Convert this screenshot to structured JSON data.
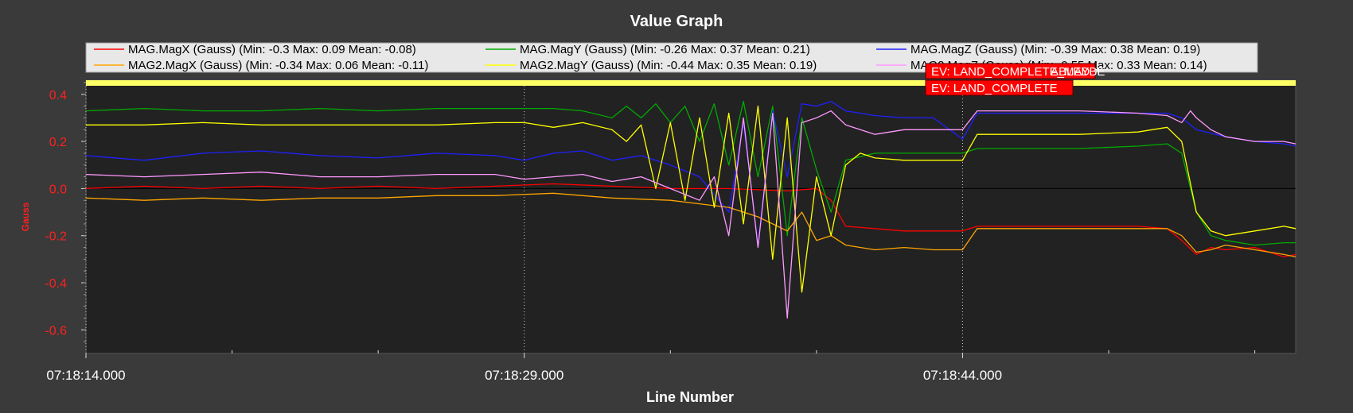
{
  "chart_data": {
    "type": "line",
    "title": "Value Graph",
    "xlabel": "Line Number",
    "ylabel": "Gauss",
    "x_range": [
      0,
      41.4
    ],
    "ylim": [
      -0.7,
      0.46
    ],
    "y_ticks": [
      -0.6,
      -0.4,
      -0.2,
      0.0,
      0.2,
      0.4
    ],
    "y_tick_labels": [
      "-0.6",
      "-0.4",
      "-0.2",
      "0.0",
      "0.2",
      "0.4"
    ],
    "x_ticks": [
      0,
      15,
      30
    ],
    "x_tick_labels": [
      "07:18:14.000",
      "07:18:29.000",
      "07:18:44.000"
    ],
    "x_minor_ticks": [
      5,
      10,
      20,
      25,
      35,
      40
    ],
    "grid": "vertical dotted at major ticks",
    "legend_placement": "top",
    "legend": [
      {
        "label": "MAG.MagX (Gauss) (Min: -0.3 Max: 0.09 Mean: -0.08)",
        "color": "#ff0000"
      },
      {
        "label": "MAG.MagY (Gauss) (Min: -0.26 Max: 0.37 Mean: 0.21)",
        "color": "#00aa00"
      },
      {
        "label": "MAG.MagZ (Gauss) (Min: -0.39 Max: 0.38 Mean: 0.19)",
        "color": "#1f1fff"
      },
      {
        "label": "MAG2.MagX (Gauss) (Min: -0.34 Max: 0.06 Mean: -0.11)",
        "color": "#ffa500"
      },
      {
        "label": "MAG2.MagY (Gauss) (Min: -0.44 Max: 0.35 Mean: 0.19)",
        "color": "#ffff00"
      },
      {
        "label": "MAG2.MagZ (Gauss) (Min: -0.55 Max: 0.33 Mean: 0.14)",
        "color": "#ff99ff"
      }
    ],
    "event_labels": [
      "EV: LAND_COMPLETE_MAYBE",
      "EV: LAND_COMPLETE"
    ],
    "event_label_partial": "ABLED",
    "colors": {
      "background": "#3a3a3a",
      "plot_background": "#222222",
      "axis_text": "#ff2020",
      "text": "#ffffff",
      "event_bg": "#ff0000",
      "top_band": "#ffff66"
    },
    "series": [
      {
        "name": "MAG.MagX (Gauss)",
        "color": "#ff0000",
        "x": [
          0,
          2,
          4,
          6,
          8,
          10,
          12,
          14,
          16,
          18,
          20,
          22,
          24,
          25,
          25.5,
          26,
          27,
          28,
          29,
          30,
          30.5,
          31,
          32,
          33,
          34,
          35,
          36,
          37,
          37.5,
          38,
          38.5,
          39,
          40,
          41,
          41.4
        ],
        "y": [
          0.0,
          0.01,
          0.0,
          0.01,
          0.0,
          0.01,
          0.0,
          0.01,
          0.02,
          0.01,
          0.0,
          0.0,
          -0.01,
          0.0,
          -0.05,
          -0.16,
          -0.17,
          -0.18,
          -0.18,
          -0.18,
          -0.16,
          -0.16,
          -0.16,
          -0.16,
          -0.16,
          -0.16,
          -0.16,
          -0.17,
          -0.22,
          -0.28,
          -0.25,
          -0.26,
          -0.25,
          -0.29,
          -0.28
        ]
      },
      {
        "name": "MAG.MagY (Gauss)",
        "color": "#00aa00",
        "x": [
          0,
          2,
          4,
          6,
          8,
          10,
          12,
          14,
          16,
          17,
          18,
          18.5,
          19,
          19.5,
          20,
          20.5,
          21,
          21.5,
          22,
          22.5,
          23,
          23.5,
          24,
          24.5,
          25,
          25.5,
          26,
          27,
          28,
          29,
          30,
          30.5,
          32,
          34,
          36,
          37,
          37.5,
          38,
          38.5,
          39,
          40,
          41,
          41.4
        ],
        "y": [
          0.33,
          0.34,
          0.33,
          0.33,
          0.34,
          0.33,
          0.34,
          0.34,
          0.34,
          0.33,
          0.3,
          0.35,
          0.3,
          0.36,
          0.28,
          0.35,
          0.2,
          0.36,
          0.1,
          0.37,
          0.05,
          0.35,
          -0.2,
          0.3,
          0.08,
          -0.1,
          0.12,
          0.15,
          0.15,
          0.15,
          0.15,
          0.17,
          0.17,
          0.17,
          0.18,
          0.19,
          0.15,
          -0.1,
          -0.2,
          -0.22,
          -0.24,
          -0.23,
          -0.23
        ]
      },
      {
        "name": "MAG.MagZ (Gauss)",
        "color": "#1f1fff",
        "x": [
          0,
          2,
          4,
          6,
          8,
          10,
          12,
          14,
          15,
          16,
          17,
          18,
          19,
          20,
          21,
          22,
          22.5,
          23,
          23.5,
          24,
          24.5,
          25,
          25.5,
          26,
          27,
          28,
          29,
          30,
          30.5,
          32,
          34,
          36,
          37,
          37.5,
          38,
          39,
          40,
          41,
          41.4
        ],
        "y": [
          0.14,
          0.12,
          0.15,
          0.16,
          0.14,
          0.13,
          0.15,
          0.14,
          0.12,
          0.15,
          0.16,
          0.12,
          0.14,
          0.1,
          0.05,
          -0.1,
          0.28,
          -0.24,
          0.33,
          0.05,
          0.36,
          0.35,
          0.37,
          0.33,
          0.31,
          0.3,
          0.3,
          0.21,
          0.32,
          0.32,
          0.32,
          0.32,
          0.32,
          0.3,
          0.25,
          0.22,
          0.2,
          0.19,
          0.18
        ]
      },
      {
        "name": "MAG2.MagX (Gauss)",
        "color": "#ffa500",
        "x": [
          0,
          2,
          4,
          6,
          8,
          10,
          12,
          14,
          16,
          18,
          20,
          22,
          23,
          24,
          24.5,
          25,
          25.5,
          26,
          27,
          28,
          29,
          30,
          30.5,
          32,
          34,
          36,
          37,
          37.5,
          38,
          38.5,
          39,
          40,
          41,
          41.4
        ],
        "y": [
          -0.04,
          -0.05,
          -0.04,
          -0.05,
          -0.04,
          -0.04,
          -0.03,
          -0.03,
          -0.02,
          -0.04,
          -0.05,
          -0.08,
          -0.12,
          -0.18,
          -0.1,
          -0.22,
          -0.2,
          -0.24,
          -0.26,
          -0.25,
          -0.26,
          -0.26,
          -0.17,
          -0.17,
          -0.17,
          -0.17,
          -0.17,
          -0.2,
          -0.27,
          -0.26,
          -0.24,
          -0.26,
          -0.28,
          -0.29
        ]
      },
      {
        "name": "MAG2.MagY (Gauss)",
        "color": "#ffff00",
        "x": [
          0,
          2,
          4,
          6,
          8,
          10,
          12,
          14,
          15,
          16,
          17,
          18,
          18.5,
          19,
          19.5,
          20,
          20.5,
          21,
          21.5,
          22,
          22.5,
          23,
          23.5,
          24,
          24.5,
          25,
          25.5,
          26,
          26.5,
          27,
          28,
          29,
          30,
          30.5,
          32,
          34,
          36,
          37,
          37.5,
          38,
          38.5,
          39,
          40,
          41,
          41.4
        ],
        "y": [
          0.27,
          0.27,
          0.28,
          0.27,
          0.27,
          0.27,
          0.27,
          0.28,
          0.28,
          0.26,
          0.28,
          0.25,
          0.2,
          0.27,
          0.0,
          0.28,
          -0.05,
          0.3,
          -0.08,
          0.32,
          -0.15,
          0.35,
          -0.3,
          0.3,
          -0.44,
          0.05,
          -0.2,
          0.1,
          0.15,
          0.13,
          0.12,
          0.12,
          0.12,
          0.23,
          0.23,
          0.23,
          0.24,
          0.26,
          0.2,
          -0.1,
          -0.18,
          -0.2,
          -0.18,
          -0.16,
          -0.17
        ]
      },
      {
        "name": "MAG2.MagZ (Gauss)",
        "color": "#ff99ff",
        "x": [
          0,
          2,
          4,
          6,
          8,
          10,
          12,
          14,
          15,
          16,
          17,
          18,
          19,
          20,
          21,
          21.5,
          22,
          22.5,
          23,
          23.5,
          24,
          24.5,
          25,
          25.5,
          26,
          27,
          28,
          29,
          30,
          30.5,
          32,
          34,
          36,
          37,
          37.5,
          37.8,
          38,
          38.5,
          39,
          40,
          41,
          41.4
        ],
        "y": [
          0.06,
          0.05,
          0.06,
          0.07,
          0.05,
          0.05,
          0.06,
          0.06,
          0.04,
          0.05,
          0.06,
          0.03,
          0.05,
          0.0,
          -0.05,
          0.05,
          -0.2,
          0.3,
          -0.25,
          0.32,
          -0.55,
          0.28,
          0.3,
          0.33,
          0.27,
          0.23,
          0.25,
          0.25,
          0.25,
          0.33,
          0.33,
          0.33,
          0.32,
          0.31,
          0.28,
          0.33,
          0.3,
          0.25,
          0.22,
          0.2,
          0.2,
          0.19
        ]
      }
    ]
  }
}
